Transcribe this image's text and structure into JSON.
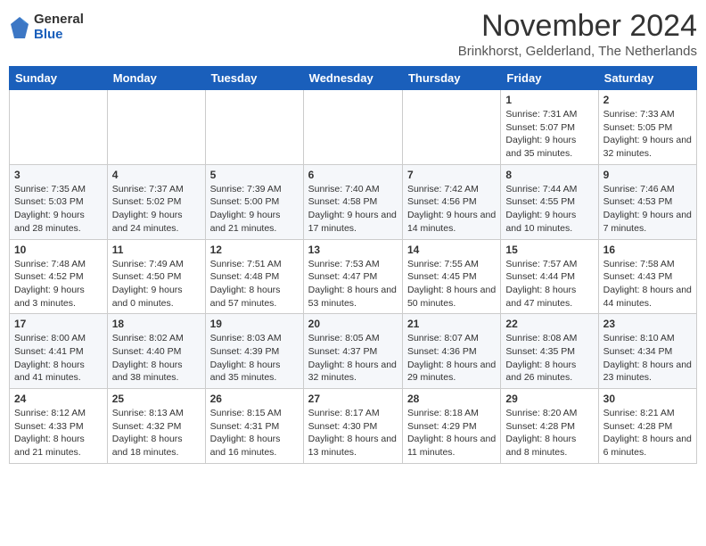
{
  "logo": {
    "general": "General",
    "blue": "Blue"
  },
  "title": "November 2024",
  "subtitle": "Brinkhorst, Gelderland, The Netherlands",
  "days_header": [
    "Sunday",
    "Monday",
    "Tuesday",
    "Wednesday",
    "Thursday",
    "Friday",
    "Saturday"
  ],
  "weeks": [
    [
      {
        "day": "",
        "info": ""
      },
      {
        "day": "",
        "info": ""
      },
      {
        "day": "",
        "info": ""
      },
      {
        "day": "",
        "info": ""
      },
      {
        "day": "",
        "info": ""
      },
      {
        "day": "1",
        "info": "Sunrise: 7:31 AM\nSunset: 5:07 PM\nDaylight: 9 hours and 35 minutes."
      },
      {
        "day": "2",
        "info": "Sunrise: 7:33 AM\nSunset: 5:05 PM\nDaylight: 9 hours and 32 minutes."
      }
    ],
    [
      {
        "day": "3",
        "info": "Sunrise: 7:35 AM\nSunset: 5:03 PM\nDaylight: 9 hours and 28 minutes."
      },
      {
        "day": "4",
        "info": "Sunrise: 7:37 AM\nSunset: 5:02 PM\nDaylight: 9 hours and 24 minutes."
      },
      {
        "day": "5",
        "info": "Sunrise: 7:39 AM\nSunset: 5:00 PM\nDaylight: 9 hours and 21 minutes."
      },
      {
        "day": "6",
        "info": "Sunrise: 7:40 AM\nSunset: 4:58 PM\nDaylight: 9 hours and 17 minutes."
      },
      {
        "day": "7",
        "info": "Sunrise: 7:42 AM\nSunset: 4:56 PM\nDaylight: 9 hours and 14 minutes."
      },
      {
        "day": "8",
        "info": "Sunrise: 7:44 AM\nSunset: 4:55 PM\nDaylight: 9 hours and 10 minutes."
      },
      {
        "day": "9",
        "info": "Sunrise: 7:46 AM\nSunset: 4:53 PM\nDaylight: 9 hours and 7 minutes."
      }
    ],
    [
      {
        "day": "10",
        "info": "Sunrise: 7:48 AM\nSunset: 4:52 PM\nDaylight: 9 hours and 3 minutes."
      },
      {
        "day": "11",
        "info": "Sunrise: 7:49 AM\nSunset: 4:50 PM\nDaylight: 9 hours and 0 minutes."
      },
      {
        "day": "12",
        "info": "Sunrise: 7:51 AM\nSunset: 4:48 PM\nDaylight: 8 hours and 57 minutes."
      },
      {
        "day": "13",
        "info": "Sunrise: 7:53 AM\nSunset: 4:47 PM\nDaylight: 8 hours and 53 minutes."
      },
      {
        "day": "14",
        "info": "Sunrise: 7:55 AM\nSunset: 4:45 PM\nDaylight: 8 hours and 50 minutes."
      },
      {
        "day": "15",
        "info": "Sunrise: 7:57 AM\nSunset: 4:44 PM\nDaylight: 8 hours and 47 minutes."
      },
      {
        "day": "16",
        "info": "Sunrise: 7:58 AM\nSunset: 4:43 PM\nDaylight: 8 hours and 44 minutes."
      }
    ],
    [
      {
        "day": "17",
        "info": "Sunrise: 8:00 AM\nSunset: 4:41 PM\nDaylight: 8 hours and 41 minutes."
      },
      {
        "day": "18",
        "info": "Sunrise: 8:02 AM\nSunset: 4:40 PM\nDaylight: 8 hours and 38 minutes."
      },
      {
        "day": "19",
        "info": "Sunrise: 8:03 AM\nSunset: 4:39 PM\nDaylight: 8 hours and 35 minutes."
      },
      {
        "day": "20",
        "info": "Sunrise: 8:05 AM\nSunset: 4:37 PM\nDaylight: 8 hours and 32 minutes."
      },
      {
        "day": "21",
        "info": "Sunrise: 8:07 AM\nSunset: 4:36 PM\nDaylight: 8 hours and 29 minutes."
      },
      {
        "day": "22",
        "info": "Sunrise: 8:08 AM\nSunset: 4:35 PM\nDaylight: 8 hours and 26 minutes."
      },
      {
        "day": "23",
        "info": "Sunrise: 8:10 AM\nSunset: 4:34 PM\nDaylight: 8 hours and 23 minutes."
      }
    ],
    [
      {
        "day": "24",
        "info": "Sunrise: 8:12 AM\nSunset: 4:33 PM\nDaylight: 8 hours and 21 minutes."
      },
      {
        "day": "25",
        "info": "Sunrise: 8:13 AM\nSunset: 4:32 PM\nDaylight: 8 hours and 18 minutes."
      },
      {
        "day": "26",
        "info": "Sunrise: 8:15 AM\nSunset: 4:31 PM\nDaylight: 8 hours and 16 minutes."
      },
      {
        "day": "27",
        "info": "Sunrise: 8:17 AM\nSunset: 4:30 PM\nDaylight: 8 hours and 13 minutes."
      },
      {
        "day": "28",
        "info": "Sunrise: 8:18 AM\nSunset: 4:29 PM\nDaylight: 8 hours and 11 minutes."
      },
      {
        "day": "29",
        "info": "Sunrise: 8:20 AM\nSunset: 4:28 PM\nDaylight: 8 hours and 8 minutes."
      },
      {
        "day": "30",
        "info": "Sunrise: 8:21 AM\nSunset: 4:28 PM\nDaylight: 8 hours and 6 minutes."
      }
    ]
  ]
}
